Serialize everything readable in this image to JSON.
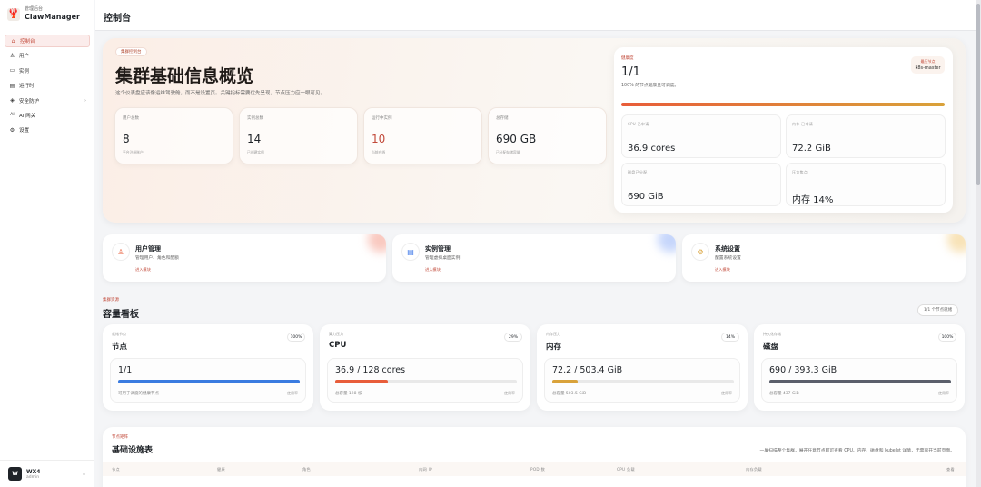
{
  "brand": {
    "sub": "管理后台",
    "name": "ClawManager",
    "logo": "🦞"
  },
  "nav": [
    {
      "label": "控制台",
      "icon": "⌂",
      "active": true
    },
    {
      "label": "用户",
      "icon": "♙"
    },
    {
      "label": "实例",
      "icon": "▭"
    },
    {
      "label": "运行时",
      "icon": "▤"
    },
    {
      "label": "安全防护",
      "icon": "◈",
      "arrow": "›"
    },
    {
      "label": "AI 网关",
      "icon": "AI"
    },
    {
      "label": "设置",
      "icon": "⚙"
    }
  ],
  "user": {
    "avatar": "W",
    "name": "WX4",
    "role": "admin",
    "chevron": "⌄"
  },
  "page_title": "控制台",
  "hero": {
    "chip": "集群控制台",
    "title": "集群基础信息概览",
    "desc": "这个仪表盘应该像运维驾驶舱，而不是设置页。关键指标需要优先呈现，节点压力应一眼可见。",
    "stats": [
      {
        "label": "用户总数",
        "value": "8",
        "sub": "平台注册账户"
      },
      {
        "label": "实例总数",
        "value": "14",
        "sub": "已创建实例"
      },
      {
        "label": "运行中实例",
        "value": "10",
        "sub": "当前在线"
      },
      {
        "label": "总存储",
        "value": "690 GB",
        "sub": "已分配存储容量"
      }
    ]
  },
  "panel": {
    "small": "健康度",
    "value": "1/1",
    "desc": "100% 的节点健康且可调度。",
    "node_label": "最压节点",
    "node_value": "k8s-master",
    "metrics": [
      {
        "label": "CPU 已申请",
        "value": "36.9 cores"
      },
      {
        "label": "内存 已申请",
        "value": "72.2 GiB"
      },
      {
        "label": "磁盘已分配",
        "value": "690 GiB"
      },
      {
        "label": "压力焦点",
        "value": "内存 14%"
      }
    ]
  },
  "quick": [
    {
      "title": "用户管理",
      "desc": "管理用户、角色和配额",
      "go": "进入模块",
      "icon": "♙",
      "color": "#e85d3a",
      "blob": "#f9c9c0"
    },
    {
      "title": "实例管理",
      "desc": "管理虚拟桌面实例",
      "go": "进入模块",
      "icon": "▤",
      "color": "#3a74e8",
      "blob": "#c6d6fb"
    },
    {
      "title": "系统设置",
      "desc": "配置系统设置",
      "go": "进入模块",
      "icon": "⚙",
      "color": "#d9a23a",
      "blob": "#f8e3b8"
    }
  ],
  "capacity": {
    "small": "集群资源",
    "title": "容量看板",
    "pill": "1/1 个节点就绪",
    "cards": [
      {
        "small": "就绪节点",
        "title": "节点",
        "pct": "100%",
        "value": "1/1",
        "fill": 1.0,
        "color": "#3a7be0",
        "foot": "可用于调度的健康节点",
        "badge": "使用率"
      },
      {
        "small": "算力压力",
        "title": "CPU",
        "pct": "29%",
        "value": "36.9 / 128 cores",
        "fill": 0.29,
        "color": "#e85d3a",
        "foot": "总容量 128 核",
        "badge": "使用率"
      },
      {
        "small": "内存压力",
        "title": "内存",
        "pct": "14%",
        "value": "72.2 / 503.4 GiB",
        "fill": 0.14,
        "color": "#d9a23a",
        "foot": "总容量 503.5 GiB",
        "badge": "使用率"
      },
      {
        "small": "持久化存储",
        "title": "磁盘",
        "pct": "100%",
        "value": "690 / 393.3 GiB",
        "fill": 1.0,
        "color": "#5b5f6b",
        "foot": "总容量 437 GiB",
        "badge": "使用率"
      }
    ]
  },
  "table": {
    "small": "节点矩阵",
    "title": "基础设施表",
    "desc": "一屏扫描整个集群，展开任意节点即可查看 CPU、内存、磁盘和 kubelet 详情，无需离开当前页面。",
    "columns": [
      "节点",
      "健康",
      "角色",
      "内网 IP",
      "POD 数",
      "CPU 负载",
      "内存负载",
      "查看"
    ]
  },
  "colors": {
    "accent": "#c24a3a"
  }
}
